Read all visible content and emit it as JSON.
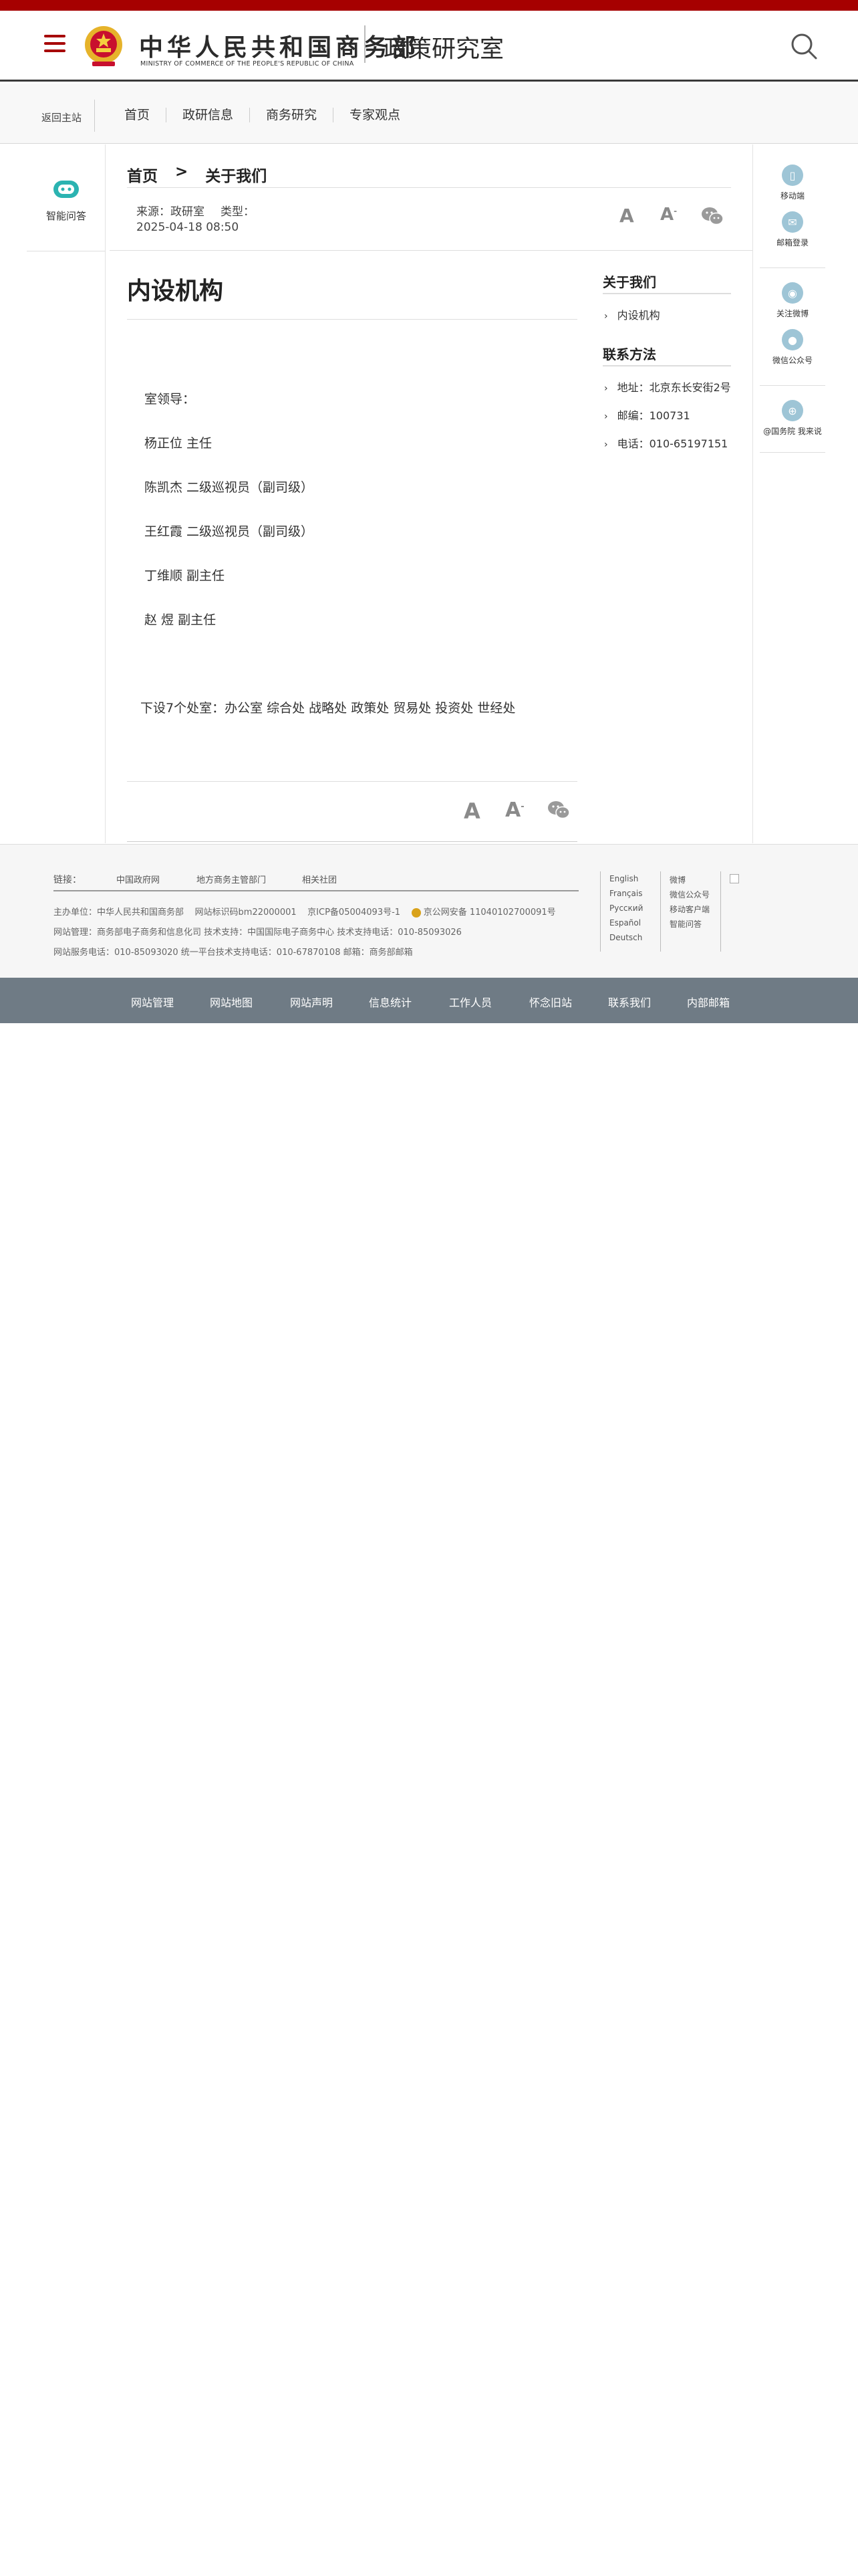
{
  "header": {
    "site_name_cn": "中华人民共和国商务部",
    "site_name_en": "MINISTRY OF COMMERCE OF THE PEOPLE'S REPUBLIC OF CHINA",
    "dept_title": "政策研究室"
  },
  "nav": {
    "back_label": "返回主站",
    "items": [
      "首页",
      "政研信息",
      "商务研究",
      "专家观点"
    ]
  },
  "left_sidebar": {
    "qa_label": "智能问答"
  },
  "right_sidebar": {
    "mobile": "移动端",
    "mail": "邮箱登录",
    "weibo": "关注微博",
    "wechat": "微信公众号",
    "intl": "@国务院 我来说"
  },
  "breadcrumb": {
    "home": "首页",
    "separator": ">",
    "current": "关于我们"
  },
  "meta": {
    "source": "来源：政研室",
    "type": "类型：",
    "date": "2025-04-18 08:50"
  },
  "font_controls": {
    "big": "A",
    "small": "A",
    "small_sup": "-"
  },
  "article": {
    "title": "内设机构",
    "lines": [
      "室领导：",
      "杨正位 主任",
      "陈凯杰 二级巡视员（副司级）",
      "王红霞 二级巡视员（副司级）",
      "丁维顺 副主任",
      "赵  煜 副主任"
    ],
    "offices": "下设7个处室：办公室 综合处 战略处 政策处 贸易处 投资处 世经处"
  },
  "aside": {
    "about_title": "关于我们",
    "about_links": [
      "内设机构"
    ],
    "contact_title": "联系方法",
    "contact_items": [
      "地址：北京东长安街2号",
      "邮编：100731",
      "电话：010-65197151"
    ]
  },
  "footer": {
    "links_label": "链接：",
    "links": [
      "中国政府网",
      "地方商务主管部门",
      "相关社团"
    ],
    "info_line1_a": "主办单位：中华人民共和国商务部",
    "info_line1_b": "网站标识码bm22000001",
    "info_line1_c": "京ICP备05004093号-1",
    "info_line1_d": "京公网安备 11040102700091号",
    "info_line2": "网站管理：商务部电子商务和信息化司    技术支持：中国国际电子商务中心    技术支持电话：010-85093026",
    "info_line3": "网站服务电话：010-85093020    统一平台技术支持电话：010-67870108    邮箱：商务部邮箱",
    "languages": [
      "English",
      "Français",
      "Русский",
      "Español",
      "Deutsch"
    ],
    "apps": [
      "微博",
      "微信公众号",
      "移动客户端",
      "智能问答"
    ]
  },
  "bottom_nav": {
    "items": [
      "网站管理",
      "网站地图",
      "网站声明",
      "信息统计",
      "工作人员",
      "怀念旧站",
      "联系我们",
      "内部邮箱"
    ]
  },
  "colors": {
    "brand_red": "#a60000",
    "bottom_nav_bg": "#6f7b85",
    "icon_teal": "#2bb3b1",
    "icon_blue": "#9ec5d6"
  }
}
